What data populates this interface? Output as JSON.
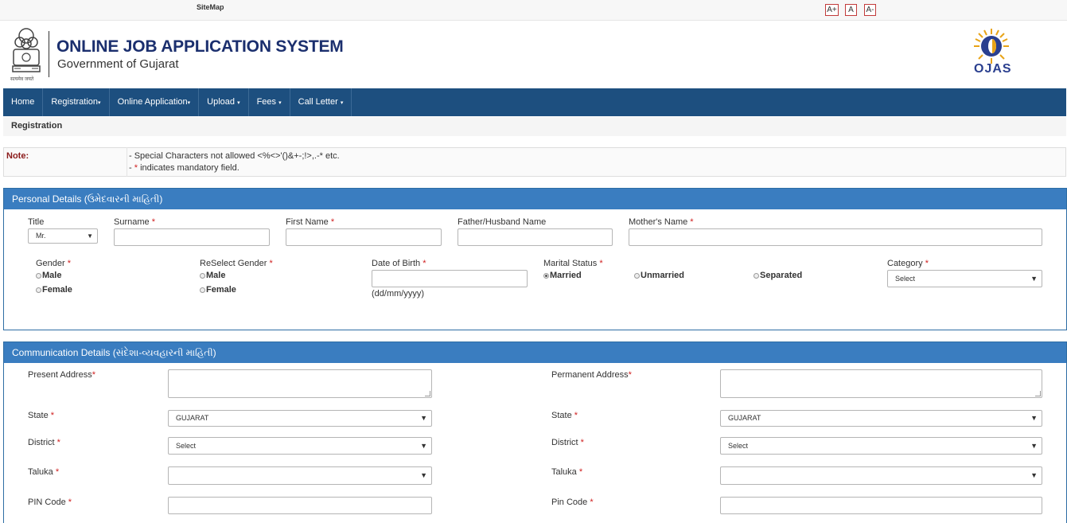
{
  "topbar": {
    "sitemap": "SiteMap",
    "font_increase": "A+",
    "font_normal": "A",
    "font_decrease": "A-"
  },
  "header": {
    "title": "ONLINE JOB APPLICATION SYSTEM",
    "subtitle": "Government of Gujarat",
    "emblem_caption": "सत्यमेव जयते",
    "logo_text": "OJAS"
  },
  "nav": {
    "items": [
      "Home",
      "Registration",
      "Online Application",
      "Upload",
      "Fees",
      "Call Letter"
    ]
  },
  "breadcrumb": "Registration",
  "note": {
    "label": "Note:",
    "line1": "- Special Characters not allowed <%<>'()&+-;!>,.-* etc.",
    "line2_prefix": "- ",
    "line2_star": "*",
    "line2_suffix": " indicates mandatory field."
  },
  "personal": {
    "heading": "Personal Details (ઉમેદવારની માહિતી)",
    "title_label": "Title",
    "title_value": "Mr.",
    "surname_label": "Surname",
    "firstname_label": "First Name",
    "father_label": "Father/Husband Name",
    "mother_label": "Mother's Name",
    "gender_label": "Gender",
    "reselect_gender_label": "ReSelect Gender",
    "male": "Male",
    "female": "Female",
    "dob_label": "Date of Birth",
    "dob_hint": "(dd/mm/yyyy)",
    "marital_label": "Marital Status",
    "married": "Married",
    "unmarried": "Unmarried",
    "separated": "Separated",
    "category_label": "Category",
    "category_value": "Select",
    "req": "*"
  },
  "communication": {
    "heading": "Communication Details (સંદેશા-વ્યવહારની માહિતી)",
    "present_address_label": "Present Address",
    "permanent_address_label": "Permanent Address",
    "state_label": "State",
    "state_value": "GUJARAT",
    "district_label": "District",
    "district_value": "Select",
    "taluka_label": "Taluka",
    "pin_label_present": "PIN Code",
    "pin_label_permanent": "Pin Code",
    "req": "*"
  },
  "colors": {
    "nav": "#1d4f7f",
    "panel_header": "#3a7dc0",
    "required": "#d02020",
    "title": "#1b2f6e"
  }
}
